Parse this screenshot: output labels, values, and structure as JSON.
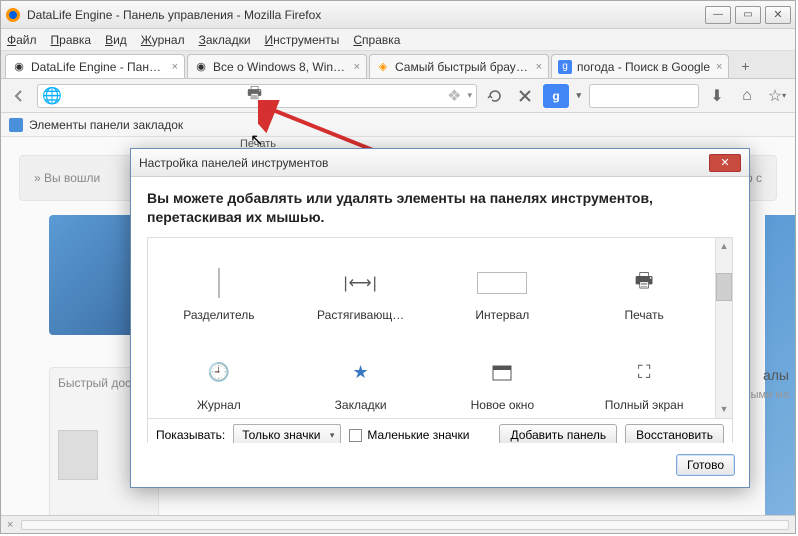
{
  "window": {
    "title": "DataLife Engine - Панель управления - Mozilla Firefox"
  },
  "menu": {
    "file": "Файл",
    "edit": "Правка",
    "view": "Вид",
    "history": "Журнал",
    "bookmarks": "Закладки",
    "tools": "Инструменты",
    "help": "Справка"
  },
  "tabs": [
    {
      "label": "DataLife Engine - Панел…",
      "active": true
    },
    {
      "label": "Все о Windows 8, Windo…",
      "active": false
    },
    {
      "label": "Самый быстрый браузе…",
      "active": false
    },
    {
      "label": "погода - Поиск в Google",
      "active": false
    }
  ],
  "bookmarks_bar": {
    "label": "Элементы панели закладок"
  },
  "toolbar_hint": "Печать",
  "bg": {
    "breadcrumb": "» Вы вошли",
    "quick": "Быстрый дос",
    "right1": "алы",
    "right2": "ными ма",
    "watch": "осмотр с"
  },
  "search_engine_label": "g",
  "dialog": {
    "title": "Настройка панелей инструментов",
    "heading": "Вы можете добавлять или удалять элементы на панелях инструментов, перетаскивая их мышью.",
    "items_row1": [
      {
        "name": "separator",
        "label": "Разделитель"
      },
      {
        "name": "flexible-space",
        "label": "Растягивающ…"
      },
      {
        "name": "spacer",
        "label": "Интервал"
      },
      {
        "name": "print",
        "label": "Печать"
      }
    ],
    "items_row2": [
      {
        "name": "history",
        "label": "Журнал"
      },
      {
        "name": "bookmarks",
        "label": "Закладки"
      },
      {
        "name": "new-window",
        "label": "Новое окно"
      },
      {
        "name": "fullscreen",
        "label": "Полный экран"
      }
    ],
    "show_label": "Показывать:",
    "show_value": "Только значки",
    "small_icons": "Маленькие значки",
    "add_panel": "Добавить панель",
    "restore": "Восстановить",
    "done": "Готово"
  }
}
